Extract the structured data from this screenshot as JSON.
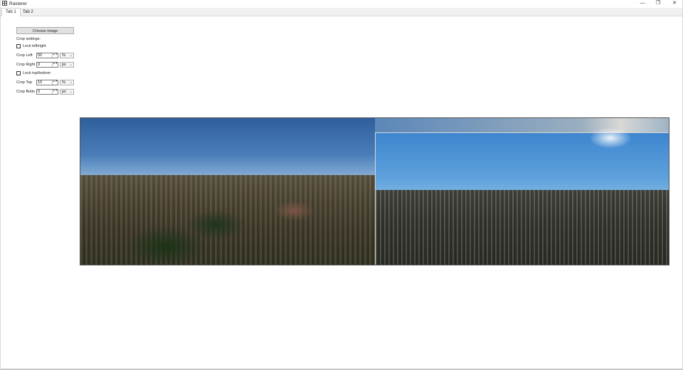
{
  "window": {
    "title": "Rasterer",
    "controls": {
      "minimize": "—",
      "maximize": "❐",
      "close": "✕"
    }
  },
  "tabs": [
    {
      "label": "Tab 1",
      "active": true
    },
    {
      "label": "Tab 2",
      "active": false
    }
  ],
  "panel": {
    "choose_button": "Choose image",
    "crop_settings_label": "Crop settings:",
    "lock_left_right": {
      "label": "Lock left/right",
      "checked": false
    },
    "crop_left": {
      "label": "Crop Left",
      "value": "50",
      "unit": "%"
    },
    "crop_right": {
      "label": "Crop Right",
      "value": "0",
      "unit": "px"
    },
    "lock_top_bottom": {
      "label": "Lock top/bottom",
      "checked": false
    },
    "crop_top": {
      "label": "Crop Top",
      "value": "10",
      "unit": "%"
    },
    "crop_bottom": {
      "label": "Crop Botto",
      "value": "0",
      "unit": "px"
    }
  },
  "icons": {
    "spin_arrows": "▲▼",
    "dropdown": "⌄"
  }
}
